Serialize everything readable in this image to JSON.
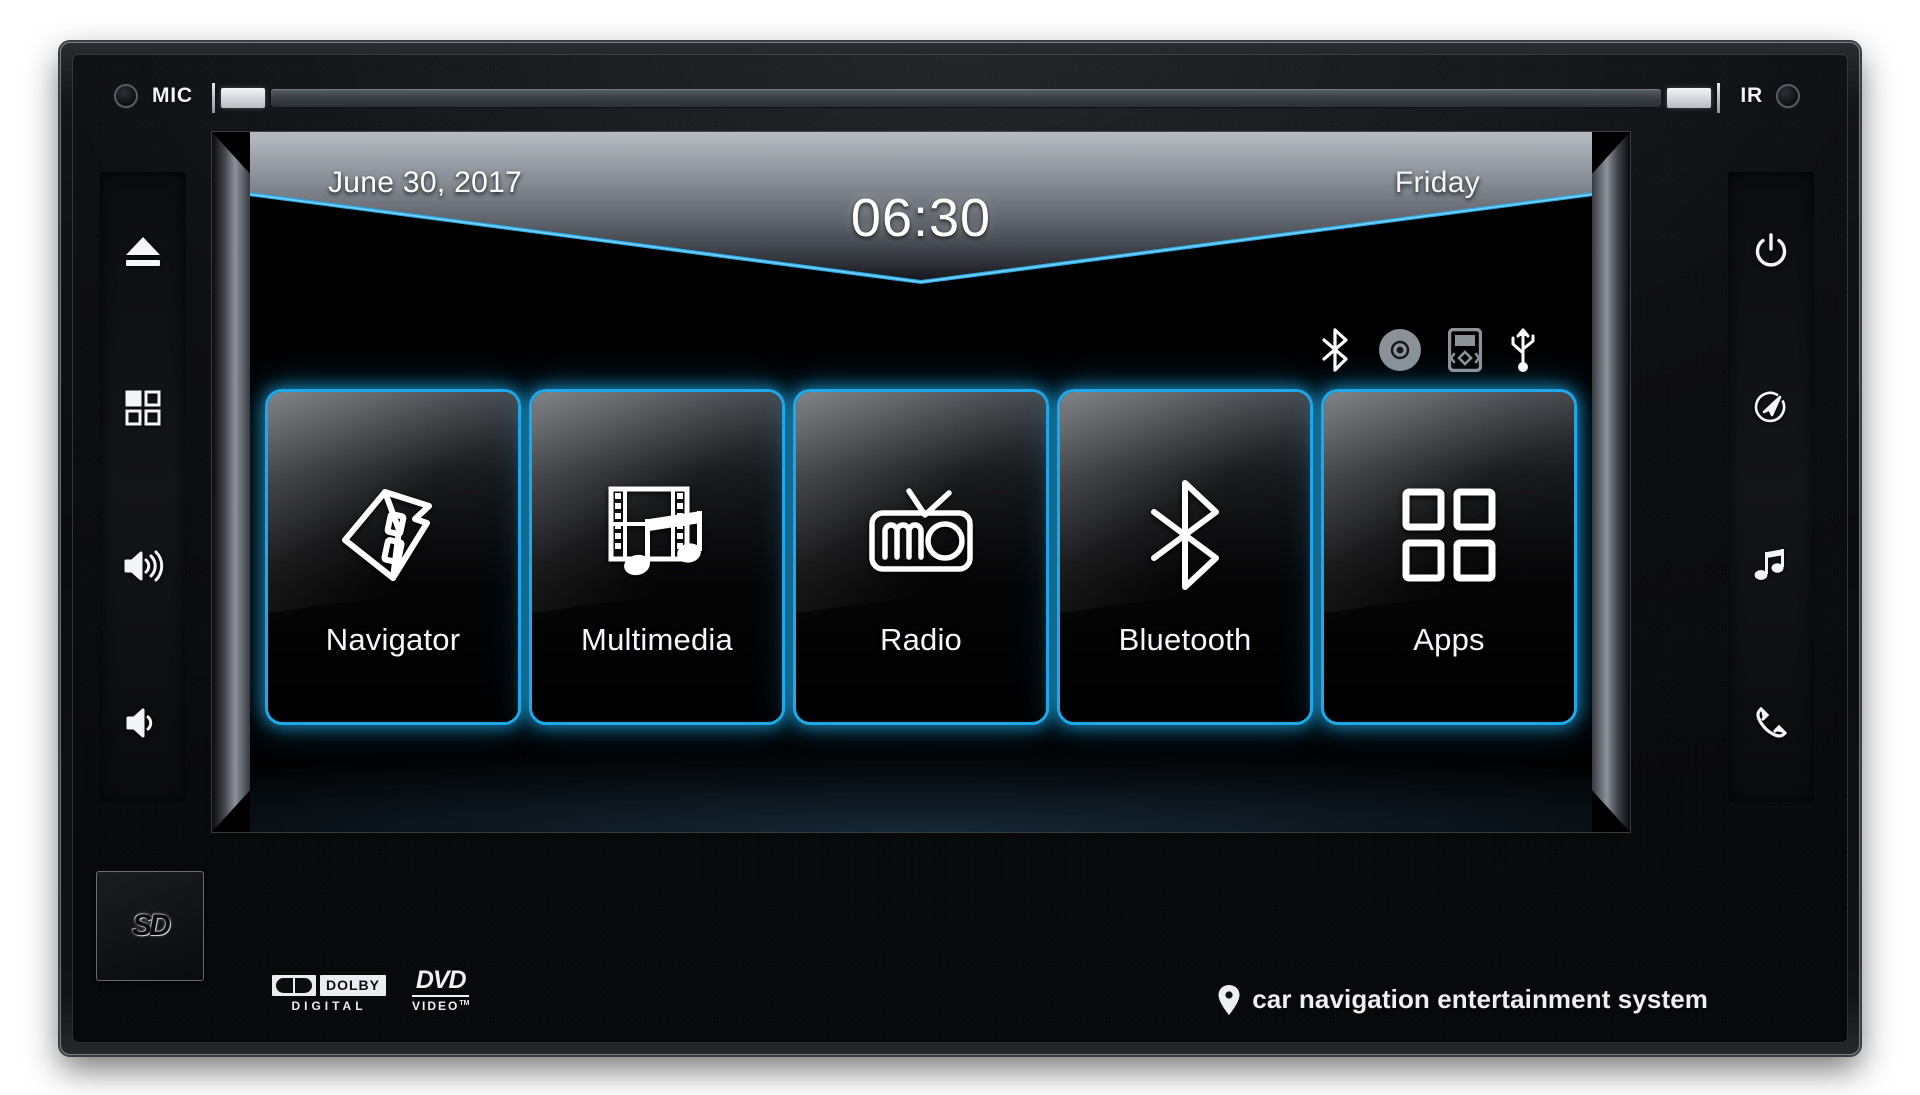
{
  "device": {
    "mic_label": "MIC",
    "ir_label": "IR",
    "sd_label": "SD"
  },
  "left_buttons": [
    {
      "name": "eject-button",
      "icon": "eject-icon",
      "label": "Eject"
    },
    {
      "name": "menu-grid-button",
      "icon": "apps-grid-icon",
      "label": "Menu"
    },
    {
      "name": "volume-up-button",
      "icon": "volume-up-icon",
      "label": "Volume Up"
    },
    {
      "name": "volume-down-button",
      "icon": "volume-down-icon",
      "label": "Volume Down"
    }
  ],
  "right_buttons": [
    {
      "name": "power-button",
      "icon": "power-icon",
      "label": "Power"
    },
    {
      "name": "navigation-button",
      "icon": "compass-navigation-icon",
      "label": "Navigation"
    },
    {
      "name": "music-button",
      "icon": "music-note-icon",
      "label": "Music"
    },
    {
      "name": "phone-button",
      "icon": "phone-handset-icon",
      "label": "Phone"
    }
  ],
  "screen": {
    "date": "June 30, 2017",
    "time": "06:30",
    "day": "Friday",
    "accent_color": "#1fa8e8",
    "status_icons": [
      {
        "name": "bluetooth-status-icon",
        "icon": "bluetooth-icon",
        "state": "active",
        "color": "#ffffff"
      },
      {
        "name": "disc-status-icon",
        "icon": "disc-icon",
        "state": "inactive",
        "color": "#8d9298"
      },
      {
        "name": "ipod-status-icon",
        "icon": "ipod-icon",
        "state": "inactive",
        "color": "#8d9298"
      },
      {
        "name": "usb-status-icon",
        "icon": "usb-icon",
        "state": "active",
        "color": "#ffffff"
      }
    ],
    "tiles": [
      {
        "name": "tile-navigator",
        "label": "Navigator",
        "icon": "navigation-arrow-house-icon"
      },
      {
        "name": "tile-multimedia",
        "label": "Multimedia",
        "icon": "film-music-icon"
      },
      {
        "name": "tile-radio",
        "label": "Radio",
        "icon": "radio-icon"
      },
      {
        "name": "tile-bluetooth",
        "label": "Bluetooth",
        "icon": "bluetooth-icon"
      },
      {
        "name": "tile-apps",
        "label": "Apps",
        "icon": "apps-grid-icon"
      }
    ]
  },
  "bottom": {
    "dolby_word": "DOLBY",
    "dolby_sub": "DIGITAL",
    "dvd_word": "DVD",
    "dvd_sub": "VIDEO",
    "dvd_tm": "TM",
    "brand_text": "car navigation entertainment system",
    "brand_icon": "map-pin-icon"
  }
}
